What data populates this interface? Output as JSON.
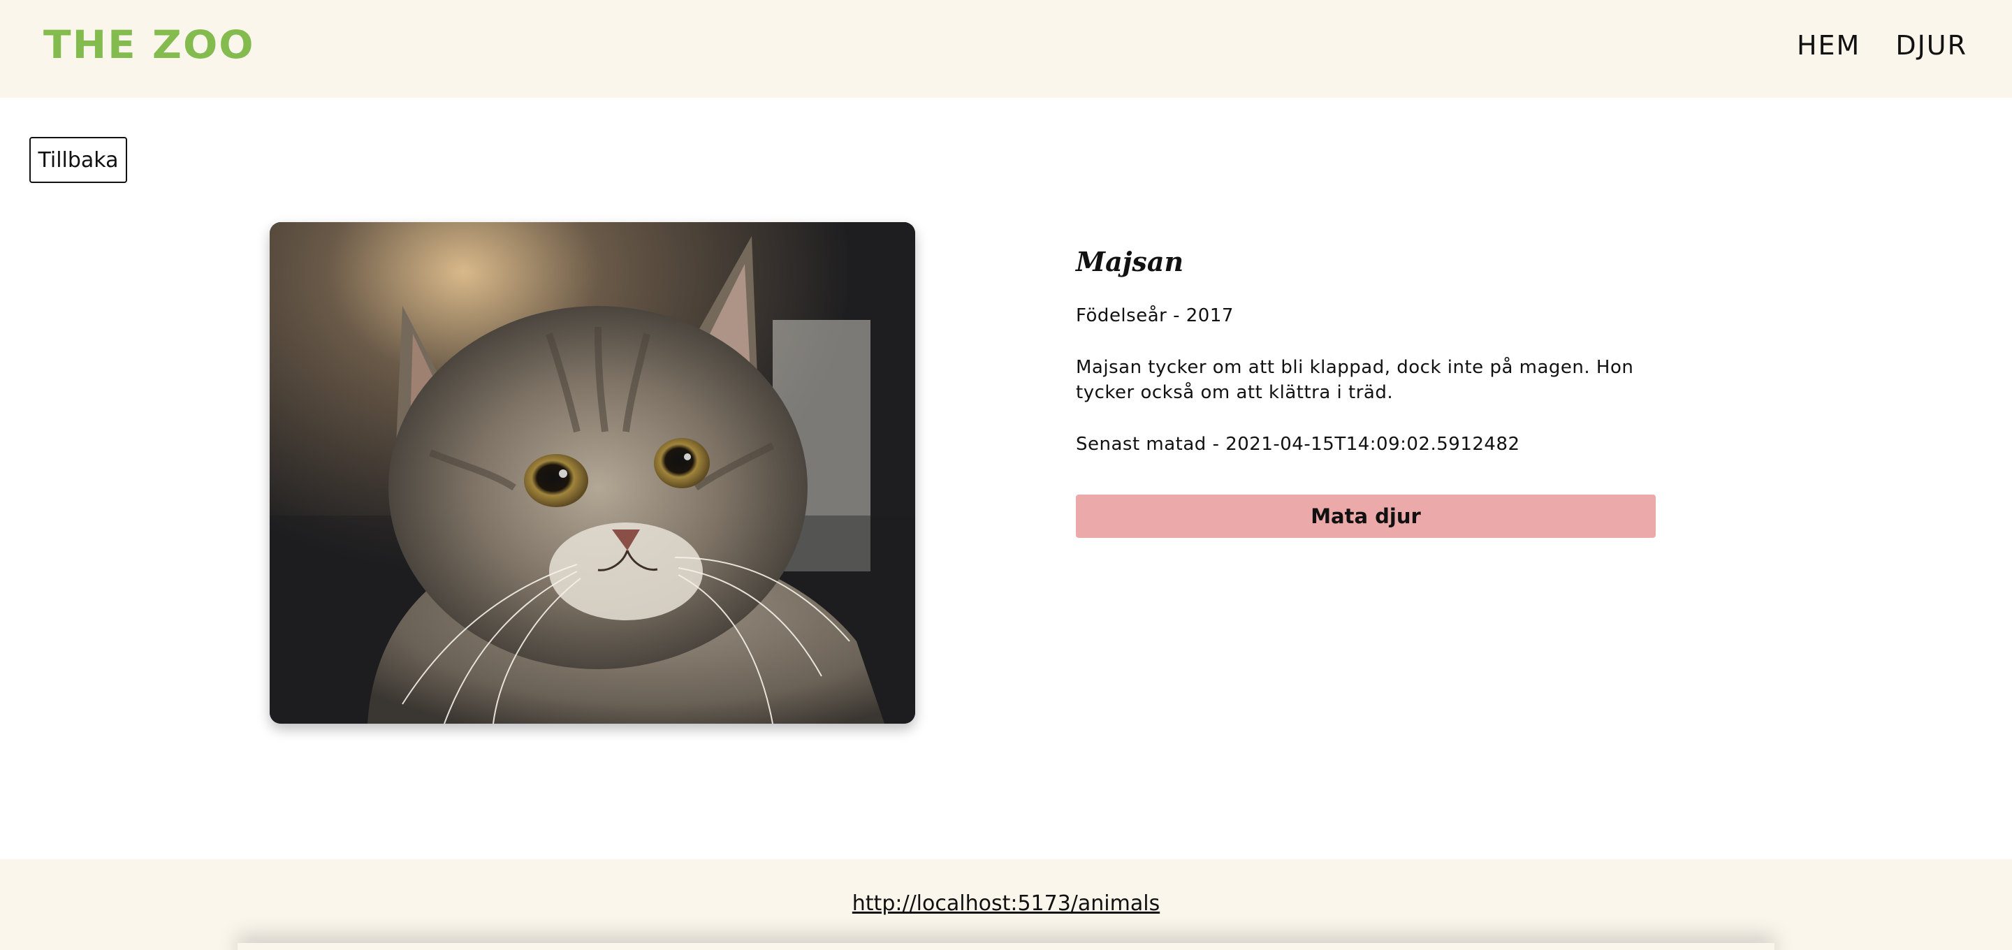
{
  "header": {
    "logo": "THE ZOO",
    "nav": [
      "HEM",
      "DJUR"
    ]
  },
  "back_button": "Tillbaka",
  "animal": {
    "name": "Majsan",
    "birth": "Födelseår - 2017",
    "description": "Majsan tycker om att bli klappad, dock inte på magen. Hon tycker också om att klättra i träd.",
    "last_fed": "Senast matad - 2021-04-15T14:09:02.5912482",
    "feed_button": "Mata djur",
    "image_icon": "cat-photo"
  },
  "footer": {
    "link": "http://localhost:5173/animals"
  },
  "colors": {
    "logo": "#83bb4f",
    "header_bg": "#faf6ec",
    "feed_button": "#eba9a9"
  }
}
